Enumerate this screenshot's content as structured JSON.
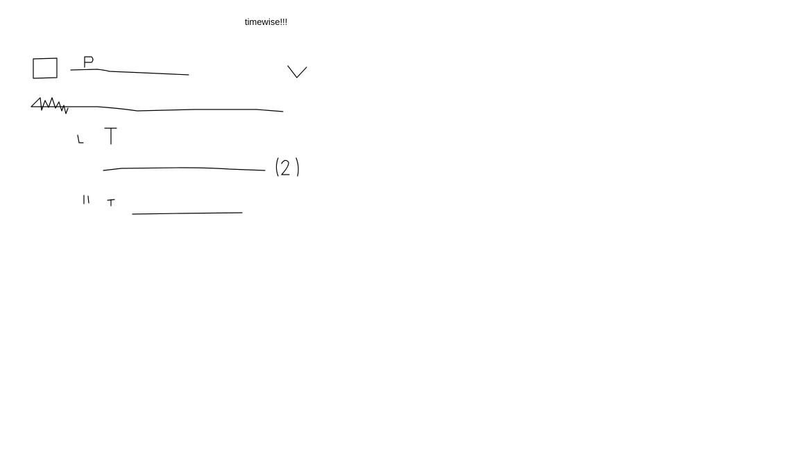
{
  "page": {
    "title": "timewise!!!",
    "background_color": "#ffffff",
    "ink_color": "#000000"
  },
  "sketch": {
    "row1": {
      "checkbox_icon": "square-outline",
      "letter": "P",
      "chevron_icon": "check-or-chevron-down"
    },
    "row2": {
      "scribble_icon": "squiggle"
    },
    "row3": {
      "mark_left": "L",
      "mark_right": "T"
    },
    "row4": {
      "count": "(2)"
    },
    "row5": {
      "mark_left": "ll",
      "mark_right": "T"
    }
  }
}
